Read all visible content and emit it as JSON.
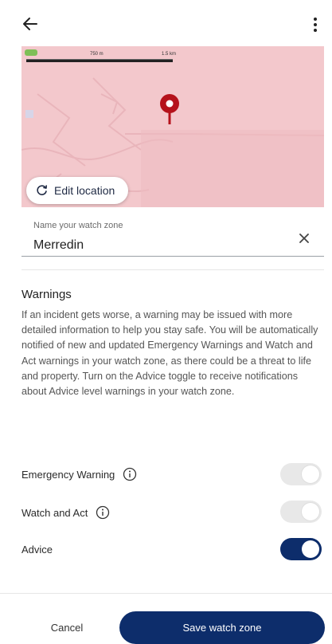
{
  "header": {
    "back_icon": "arrow-left-icon",
    "menu_icon": "more-vert-icon"
  },
  "map": {
    "scale_labels": [
      "750 m",
      "1.5 km"
    ],
    "pin_color": "#b5121b",
    "overlay_color": "#f3c8cc",
    "edit_location_label": "Edit location",
    "edit_location_icon": "refresh-pin-icon"
  },
  "name_field": {
    "label": "Name your watch zone",
    "value": "Merredin",
    "clear_icon": "close-icon"
  },
  "warnings": {
    "title": "Warnings",
    "description": "If an incident gets worse, a warning may be issued with more detailed information to help you stay safe. You will be automatically notified of new and updated Emergency Warnings and Watch and Act warnings in your watch zone, as there could be a threat to life and property. Turn on the Advice toggle to receive notifications about Advice level warnings in your watch zone."
  },
  "toggles": [
    {
      "label": "Emergency Warning",
      "has_info": true,
      "state": "on-disabled"
    },
    {
      "label": "Watch and Act",
      "has_info": true,
      "state": "on-disabled"
    },
    {
      "label": "Advice",
      "has_info": false,
      "state": "on"
    }
  ],
  "footer": {
    "cancel_label": "Cancel",
    "save_label": "Save watch zone",
    "accent_color": "#0d2d6b"
  }
}
